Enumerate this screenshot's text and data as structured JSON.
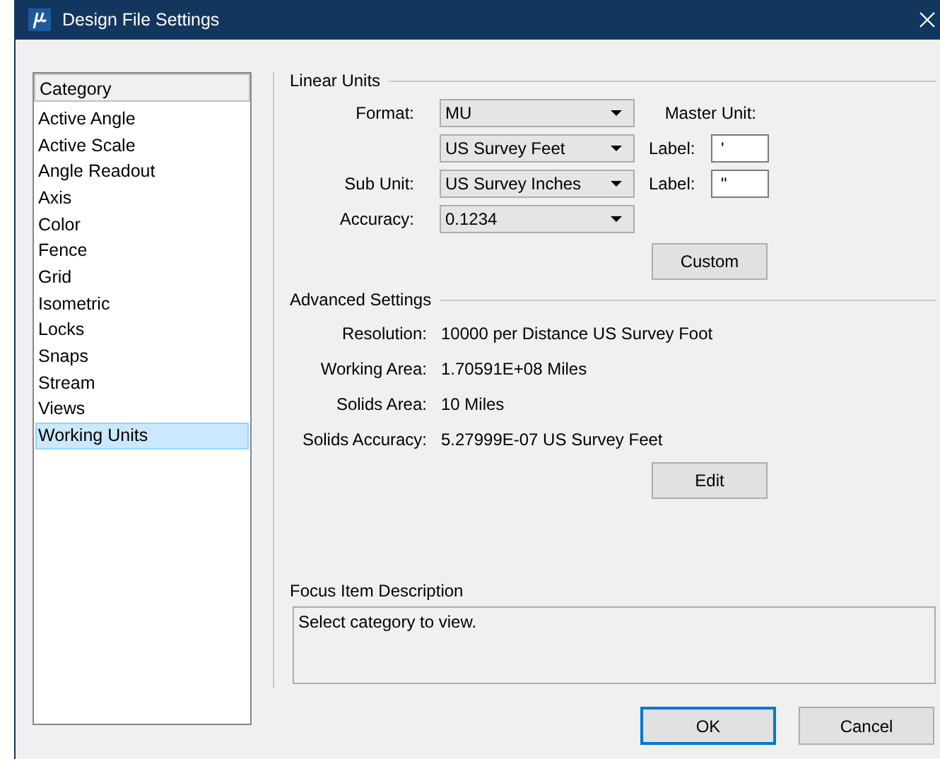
{
  "window": {
    "title": "Design File Settings"
  },
  "category_list": {
    "header": "Category",
    "items": [
      {
        "label": "Active Angle",
        "selected": false
      },
      {
        "label": "Active Scale",
        "selected": false
      },
      {
        "label": "Angle Readout",
        "selected": false
      },
      {
        "label": "Axis",
        "selected": false
      },
      {
        "label": "Color",
        "selected": false
      },
      {
        "label": "Fence",
        "selected": false
      },
      {
        "label": "Grid",
        "selected": false
      },
      {
        "label": "Isometric",
        "selected": false
      },
      {
        "label": "Locks",
        "selected": false
      },
      {
        "label": "Snaps",
        "selected": false
      },
      {
        "label": "Stream",
        "selected": false
      },
      {
        "label": "Views",
        "selected": false
      },
      {
        "label": "Working Units",
        "selected": true
      }
    ]
  },
  "linear_units": {
    "title": "Linear Units",
    "fields": [
      {
        "label": "Format:",
        "value": "MU"
      },
      {
        "label": "Master Unit:",
        "value": "US Survey Feet",
        "unit_label": {
          "label": "Label:",
          "value": "'"
        }
      },
      {
        "label": "Sub Unit:",
        "value": "US Survey Inches",
        "unit_label": {
          "label": "Label:",
          "value": "\""
        }
      },
      {
        "label": "Accuracy:",
        "value": "0.1234"
      }
    ],
    "button": "Custom"
  },
  "advanced_settings": {
    "title": "Advanced Settings",
    "rows": [
      {
        "label": "Resolution:",
        "value": "10000 per Distance US Survey Foot"
      },
      {
        "label": "Working Area:",
        "value": "1.70591E+08 Miles"
      },
      {
        "label": "Solids Area:",
        "value": "10 Miles"
      },
      {
        "label": "Solids Accuracy:",
        "value": "5.27999E-07 US Survey Feet"
      }
    ],
    "button": "Edit"
  },
  "focus_item_description": {
    "title": "Focus Item Description",
    "text": "Select category to view."
  },
  "buttons": [
    {
      "label": "OK",
      "default": true
    },
    {
      "label": "Cancel",
      "default": false
    }
  ]
}
